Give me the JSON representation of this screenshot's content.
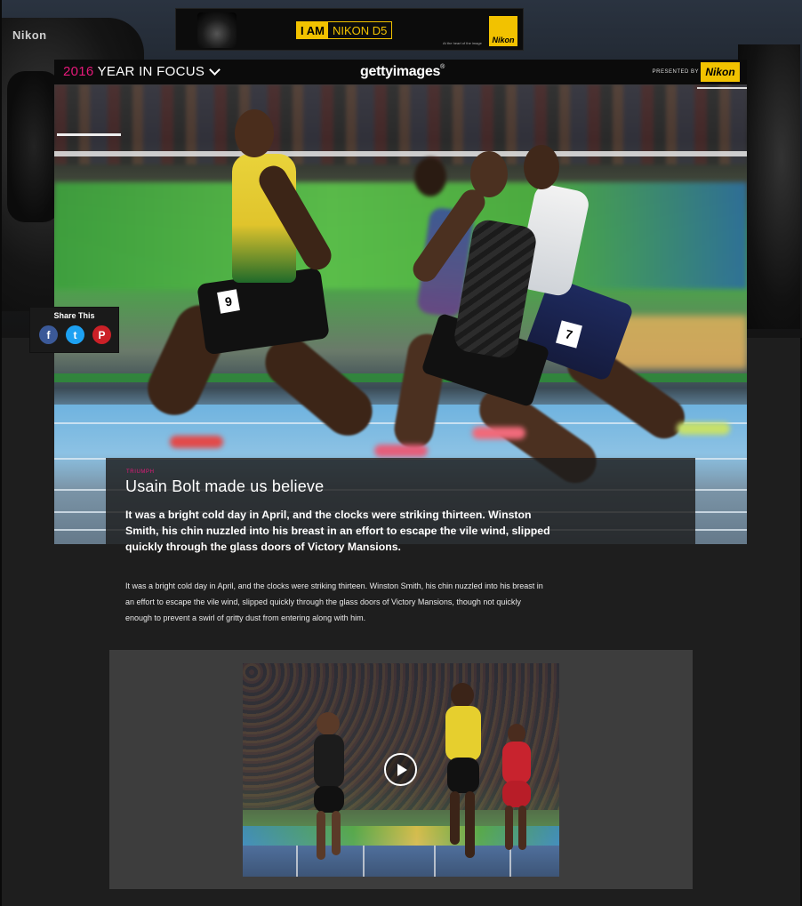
{
  "ad_banner": {
    "tag_bold": "I AM",
    "tag_model": "NIKON D5",
    "tagline": "At the heart of the image",
    "brand": "Nikon"
  },
  "camera_decor": {
    "brand": "Nikon"
  },
  "header": {
    "year": "2016",
    "section_title": "YEAR IN FOCUS",
    "logo_text": "gettyimages",
    "logo_mark": "®",
    "presented_by": "PRESENTED BY",
    "sponsor": "Nikon"
  },
  "hero": {
    "bibs": [
      "9",
      "7"
    ]
  },
  "share": {
    "label": "Share This",
    "buttons": [
      {
        "icon": "facebook-icon",
        "glyph": "f"
      },
      {
        "icon": "twitter-icon",
        "glyph": "t"
      },
      {
        "icon": "pinterest-icon",
        "glyph": "P"
      }
    ]
  },
  "caption": {
    "kicker": "TRIUMPH",
    "title": "Usain Bolt made us believe",
    "lede": "It was a bright cold day in April, and the clocks were striking thirteen. Winston Smith, his chin nuzzled into his breast in an effort to escape the vile wind, slipped quickly through the glass doors of Victory Mansions."
  },
  "body": {
    "paragraph": "It was a bright cold day in April, and the clocks were striking thirteen. Winston Smith, his chin nuzzled into his breast in an effort to escape the vile wind, slipped quickly through the glass doors of Victory Mansions, though not quickly enough to prevent a swirl of gritty dust from entering along with him."
  },
  "video": {
    "play_icon": "play-icon"
  },
  "colors": {
    "accent_pink": "#e5197a",
    "nikon_yellow": "#f2c200",
    "background": "#1e1e1e",
    "video_panel": "#3d3d3d"
  }
}
